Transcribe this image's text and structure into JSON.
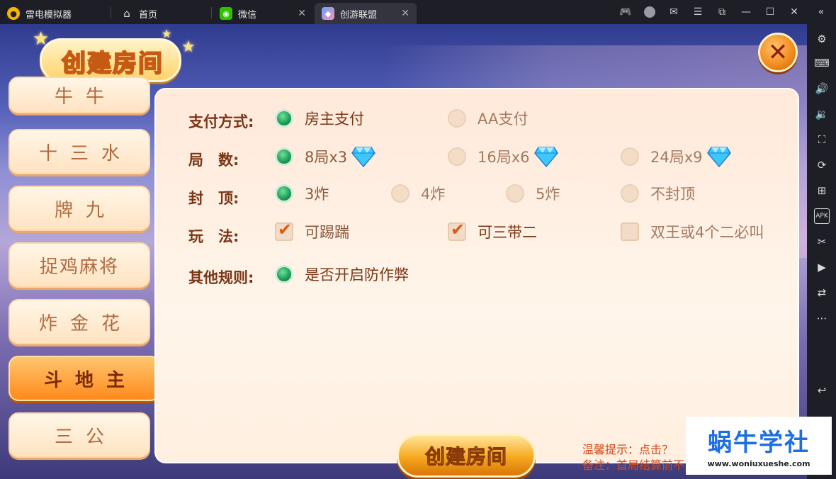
{
  "emulator": {
    "tabs": [
      {
        "label": "雷电模拟器"
      },
      {
        "label": "首页"
      },
      {
        "label": "微信"
      },
      {
        "label": "创游联盟"
      }
    ]
  },
  "game": {
    "title": "创建房间",
    "close_symbol": "✕",
    "categories": [
      "牛牛",
      "十三水",
      "牌九",
      "捉鸡麻将",
      "炸金花",
      "斗地主",
      "三公"
    ],
    "active_category": "斗地主",
    "rules": {
      "payment": {
        "label": "支付方式:",
        "options": [
          {
            "text": "房主支付",
            "selected": true
          },
          {
            "text": "AA支付",
            "selected": false
          }
        ]
      },
      "rounds": {
        "label": "局　数:",
        "options": [
          {
            "text": "8局x3",
            "selected": true
          },
          {
            "text": "16局x6",
            "selected": false
          },
          {
            "text": "24局x9",
            "selected": false
          }
        ]
      },
      "cap": {
        "label": "封　顶:",
        "options": [
          {
            "text": "3炸",
            "selected": true
          },
          {
            "text": "4炸",
            "selected": false
          },
          {
            "text": "5炸",
            "selected": false
          },
          {
            "text": "不封顶",
            "selected": false
          }
        ]
      },
      "play": {
        "label": "玩　法:",
        "options": [
          {
            "text": "可踢踹",
            "checked": true
          },
          {
            "text": "可三带二",
            "checked": true
          },
          {
            "text": "双王或4个二必叫",
            "checked": false
          }
        ]
      },
      "other": {
        "label": "其他规则:",
        "options": [
          {
            "text": "是否开启防作弊",
            "selected": true
          }
        ]
      }
    },
    "create_button": "创建房间",
    "tips": {
      "line1": "温馨提示：点击？",
      "line2": "备注：首局结算前不"
    }
  },
  "watermark": {
    "title": "蜗牛学社",
    "url": "www.woniuxueshe.com"
  },
  "colors": {
    "accent_orange": "#f6a71e",
    "radio_green": "#1c9a52",
    "label_brown": "#7a3616",
    "tip_red": "#d24a18"
  }
}
